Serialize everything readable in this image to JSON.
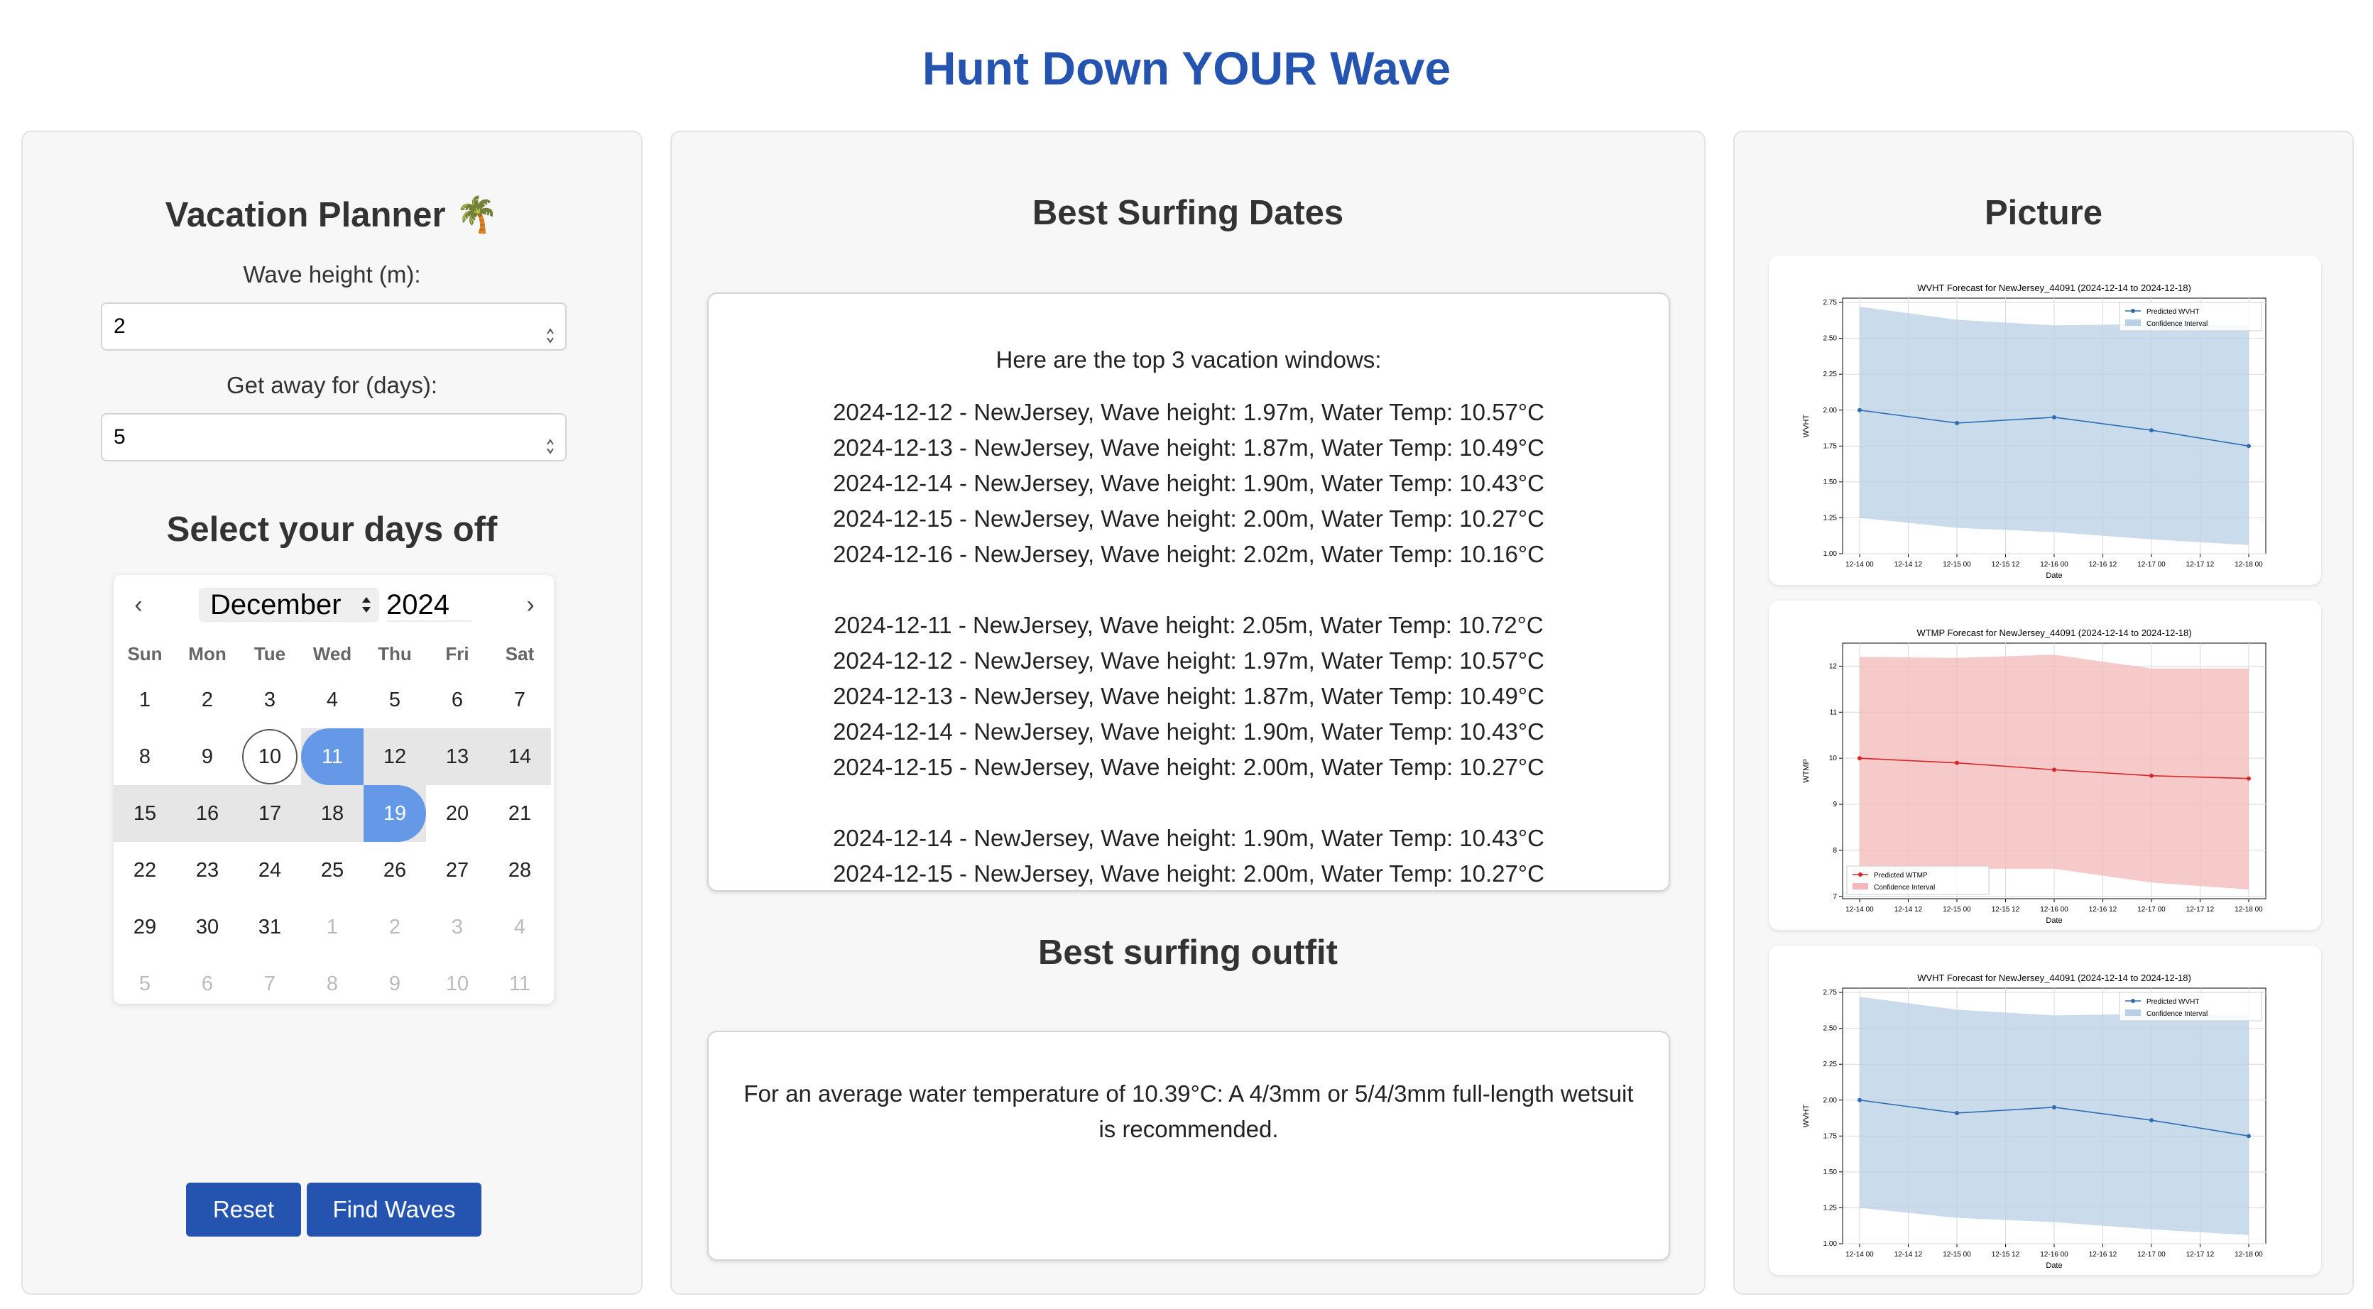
{
  "app": {
    "title": "Hunt Down YOUR Wave"
  },
  "planner": {
    "title": "Vacation Planner 🌴",
    "wave_height_label": "Wave height (m):",
    "wave_height_value": "2",
    "days_label": "Get away for (days):",
    "days_value": "5",
    "select_days_title": "Select your days off",
    "reset_label": "Reset",
    "find_label": "Find Waves"
  },
  "calendar": {
    "month": "December",
    "year": "2024",
    "prev_icon": "‹",
    "next_icon": "›",
    "weekdays": [
      "Sun",
      "Mon",
      "Tue",
      "Wed",
      "Thu",
      "Fri",
      "Sat"
    ],
    "days": [
      "1",
      "2",
      "3",
      "4",
      "5",
      "6",
      "7",
      "8",
      "9",
      "10",
      "11",
      "12",
      "13",
      "14",
      "15",
      "16",
      "17",
      "18",
      "19",
      "20",
      "21",
      "22",
      "23",
      "24",
      "25",
      "26",
      "27",
      "28",
      "29",
      "30",
      "31"
    ],
    "next_month_days": [
      "1",
      "2",
      "3",
      "4",
      "5",
      "6",
      "7",
      "8",
      "9",
      "10",
      "11"
    ],
    "today": "10",
    "range_start": "11",
    "range_end": "19"
  },
  "dates": {
    "title": "Best Surfing Dates",
    "intro": "Here are the top 3 vacation windows:",
    "windows": [
      [
        "2024-12-12 - NewJersey, Wave height: 1.97m, Water Temp: 10.57°C",
        "2024-12-13 - NewJersey, Wave height: 1.87m, Water Temp: 10.49°C",
        "2024-12-14 - NewJersey, Wave height: 1.90m, Water Temp: 10.43°C",
        "2024-12-15 - NewJersey, Wave height: 2.00m, Water Temp: 10.27°C",
        "2024-12-16 - NewJersey, Wave height: 2.02m, Water Temp: 10.16°C"
      ],
      [
        "2024-12-11 - NewJersey, Wave height: 2.05m, Water Temp: 10.72°C",
        "2024-12-12 - NewJersey, Wave height: 1.97m, Water Temp: 10.57°C",
        "2024-12-13 - NewJersey, Wave height: 1.87m, Water Temp: 10.49°C",
        "2024-12-14 - NewJersey, Wave height: 1.90m, Water Temp: 10.43°C",
        "2024-12-15 - NewJersey, Wave height: 2.00m, Water Temp: 10.27°C"
      ],
      [
        "2024-12-14 - NewJersey, Wave height: 1.90m, Water Temp: 10.43°C",
        "2024-12-15 - NewJersey, Wave height: 2.00m, Water Temp: 10.27°C"
      ]
    ]
  },
  "outfit": {
    "title": "Best surfing outfit",
    "text": "For an average water temperature of 10.39°C: A 4/3mm or 5/4/3mm full-length wetsuit is recommended."
  },
  "picture": {
    "title": "Picture"
  },
  "chart_data": [
    {
      "type": "line",
      "title": "WVHT Forecast for NewJersey_44091 (2024-12-14 to 2024-12-18)",
      "xlabel": "Date",
      "ylabel": "WVHT",
      "x_ticks": [
        "12-14 00",
        "12-14 12",
        "12-15 00",
        "12-15 12",
        "12-16 00",
        "12-16 12",
        "12-17 00",
        "12-17 12",
        "12-18 00"
      ],
      "y_ticks": [
        "1.00",
        "1.25",
        "1.50",
        "1.75",
        "2.00",
        "2.25",
        "2.50",
        "2.75"
      ],
      "ylim": [
        1.0,
        2.78
      ],
      "x": [
        "12-14 00",
        "12-15 00",
        "12-16 00",
        "12-17 00",
        "12-18 00"
      ],
      "series": [
        {
          "name": "Predicted WVHT",
          "values": [
            2.0,
            1.91,
            1.95,
            1.86,
            1.75
          ],
          "color": "#2f6db1"
        },
        {
          "name": "Confidence Interval",
          "upper": [
            2.72,
            2.63,
            2.59,
            2.6,
            2.59
          ],
          "lower": [
            1.25,
            1.18,
            1.15,
            1.1,
            1.06
          ],
          "color": "#b8cfe6"
        }
      ],
      "legend": "top-right"
    },
    {
      "type": "line",
      "title": "WTMP Forecast for NewJersey_44091 (2024-12-14 to 2024-12-18)",
      "xlabel": "Date",
      "ylabel": "WTMP",
      "x_ticks": [
        "12-14 00",
        "12-14 12",
        "12-15 00",
        "12-15 12",
        "12-16 00",
        "12-16 12",
        "12-17 00",
        "12-17 12",
        "12-18 00"
      ],
      "y_ticks": [
        "7",
        "8",
        "9",
        "10",
        "11",
        "12"
      ],
      "ylim": [
        6.95,
        12.5
      ],
      "x": [
        "12-14 00",
        "12-15 00",
        "12-16 00",
        "12-17 00",
        "12-18 00"
      ],
      "series": [
        {
          "name": "Predicted WTMP",
          "values": [
            10.0,
            9.9,
            9.75,
            9.62,
            9.56
          ],
          "color": "#d62728"
        },
        {
          "name": "Confidence Interval",
          "upper": [
            12.2,
            12.18,
            12.25,
            11.95,
            11.95
          ],
          "lower": [
            7.6,
            7.6,
            7.6,
            7.3,
            7.15
          ],
          "color": "#f4b8b8"
        }
      ],
      "legend": "bottom-left"
    },
    {
      "type": "line",
      "title": "WVHT Forecast for NewJersey_44091 (2024-12-14 to 2024-12-18)",
      "xlabel": "Date",
      "ylabel": "WVHT",
      "x_ticks": [
        "12-14 00",
        "12-14 12",
        "12-15 00",
        "12-15 12",
        "12-16 00",
        "12-16 12",
        "12-17 00",
        "12-17 12",
        "12-18 00"
      ],
      "y_ticks": [
        "1.00",
        "1.25",
        "1.50",
        "1.75",
        "2.00",
        "2.25",
        "2.50",
        "2.75"
      ],
      "ylim": [
        1.0,
        2.78
      ],
      "x": [
        "12-14 00",
        "12-15 00",
        "12-16 00",
        "12-17 00",
        "12-18 00"
      ],
      "series": [
        {
          "name": "Predicted WVHT",
          "values": [
            2.0,
            1.91,
            1.95,
            1.86,
            1.75
          ],
          "color": "#2f6db1"
        },
        {
          "name": "Confidence Interval",
          "upper": [
            2.72,
            2.63,
            2.59,
            2.6,
            2.59
          ],
          "lower": [
            1.25,
            1.18,
            1.15,
            1.1,
            1.06
          ],
          "color": "#b8cfe6"
        }
      ],
      "legend": "top-right"
    }
  ]
}
